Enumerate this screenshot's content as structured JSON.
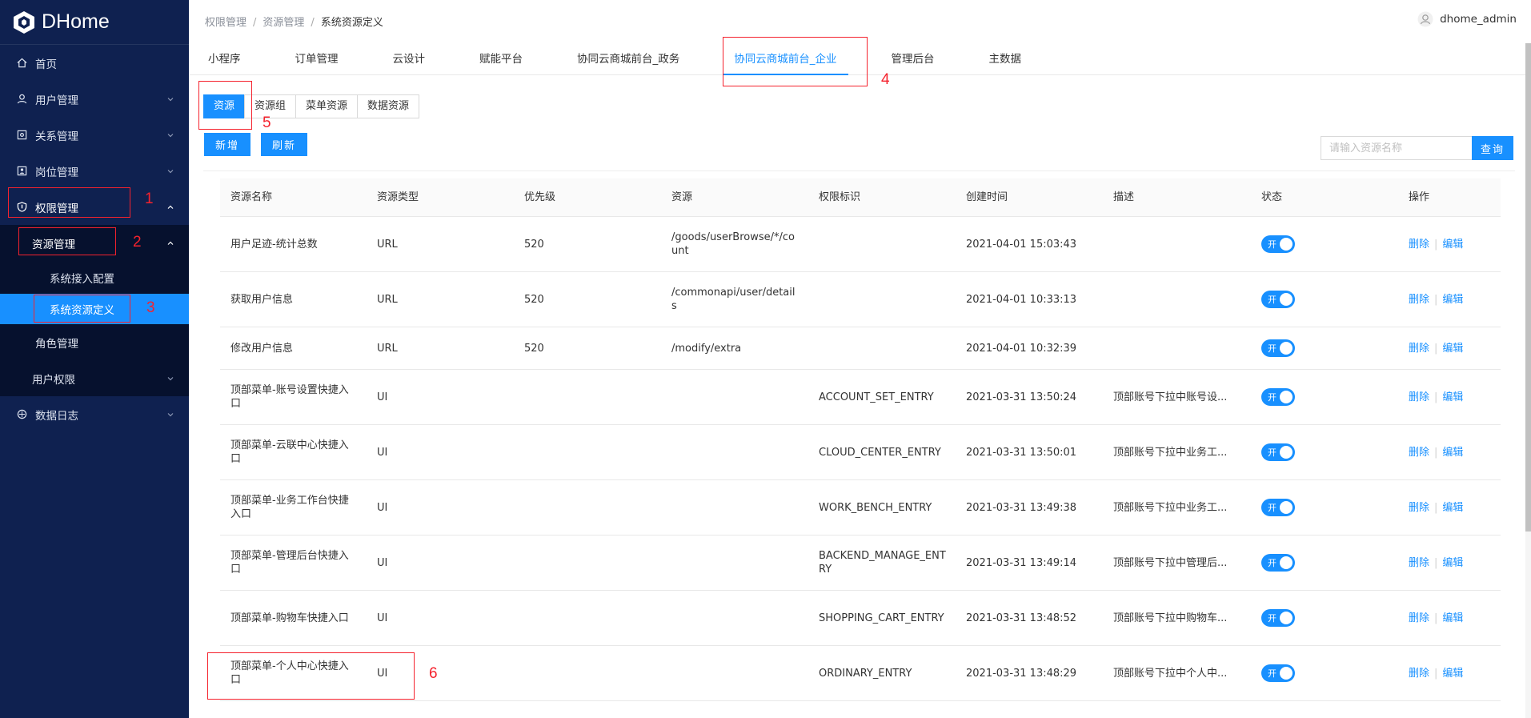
{
  "app": {
    "title": "DHome"
  },
  "sidebar": {
    "items": [
      {
        "label": "首页",
        "icon": "home-icon"
      },
      {
        "label": "用户管理",
        "icon": "user-icon"
      },
      {
        "label": "关系管理",
        "icon": "relation-icon"
      },
      {
        "label": "岗位管理",
        "icon": "post-icon"
      },
      {
        "label": "权限管理",
        "icon": "shield-icon"
      },
      {
        "label": "数据日志",
        "icon": "log-icon"
      }
    ],
    "sub": {
      "resource_label": "资源管理",
      "system_access_label": "系统接入配置",
      "system_resource_label": "系统资源定义",
      "role_label": "角色管理",
      "user_perm_label": "用户权限"
    }
  },
  "header": {
    "breadcrumb": [
      "权限管理",
      "资源管理",
      "系统资源定义"
    ],
    "username": "dhome_admin"
  },
  "top_tabs": [
    "小程序",
    "订单管理",
    "云设计",
    "赋能平台",
    "协同云商城前台_政务",
    "协同云商城前台_企业",
    "管理后台",
    "主数据"
  ],
  "sub_tabs": [
    "资源",
    "资源组",
    "菜单资源",
    "数据资源"
  ],
  "actions": {
    "add": "新增",
    "refresh": "刷新",
    "search_placeholder": "请输入资源名称",
    "search": "查询"
  },
  "table": {
    "headers": [
      "资源名称",
      "资源类型",
      "优先级",
      "资源",
      "权限标识",
      "创建时间",
      "描述",
      "状态",
      "操作"
    ],
    "rows": [
      {
        "name": "用户足迹-统计总数",
        "type": "URL",
        "priority": "520",
        "resource": "/goods/userBrowse/*/count",
        "perm": "",
        "created": "2021-04-01 15:03:43",
        "desc": "",
        "status": "开"
      },
      {
        "name": "获取用户信息",
        "type": "URL",
        "priority": "520",
        "resource": "/commonapi/user/details",
        "perm": "",
        "created": "2021-04-01 10:33:13",
        "desc": "",
        "status": "开"
      },
      {
        "name": "修改用户信息",
        "type": "URL",
        "priority": "520",
        "resource": "/modify/extra",
        "perm": "",
        "created": "2021-04-01 10:32:39",
        "desc": "",
        "status": "开"
      },
      {
        "name": "顶部菜单-账号设置快捷入口",
        "type": "UI",
        "priority": "",
        "resource": "",
        "perm": "ACCOUNT_SET_ENTRY",
        "created": "2021-03-31 13:50:24",
        "desc": "顶部账号下拉中账号设...",
        "status": "开"
      },
      {
        "name": "顶部菜单-云联中心快捷入口",
        "type": "UI",
        "priority": "",
        "resource": "",
        "perm": "CLOUD_CENTER_ENTRY",
        "created": "2021-03-31 13:50:01",
        "desc": "顶部账号下拉中业务工...",
        "status": "开"
      },
      {
        "name": "顶部菜单-业务工作台快捷入口",
        "type": "UI",
        "priority": "",
        "resource": "",
        "perm": "WORK_BENCH_ENTRY",
        "created": "2021-03-31 13:49:38",
        "desc": "顶部账号下拉中业务工...",
        "status": "开"
      },
      {
        "name": "顶部菜单-管理后台快捷入口",
        "type": "UI",
        "priority": "",
        "resource": "",
        "perm": "BACKEND_MANAGE_ENTRY",
        "created": "2021-03-31 13:49:14",
        "desc": "顶部账号下拉中管理后...",
        "status": "开"
      },
      {
        "name": "顶部菜单-购物车快捷入口",
        "type": "UI",
        "priority": "",
        "resource": "",
        "perm": "SHOPPING_CART_ENTRY",
        "created": "2021-03-31 13:48:52",
        "desc": "顶部账号下拉中购物车...",
        "status": "开"
      },
      {
        "name": "顶部菜单-个人中心快捷入口",
        "type": "UI",
        "priority": "",
        "resource": "",
        "perm": "ORDINARY_ENTRY",
        "created": "2021-03-31 13:48:29",
        "desc": "顶部账号下拉中个人中...",
        "status": "开"
      }
    ],
    "op_delete": "删除",
    "op_edit": "编辑"
  },
  "annotations": [
    "1",
    "2",
    "3",
    "4",
    "5",
    "6"
  ],
  "colors": {
    "sidebar_bg": "#0f2150",
    "primary": "#1890ff",
    "annotation": "#f5222d"
  }
}
